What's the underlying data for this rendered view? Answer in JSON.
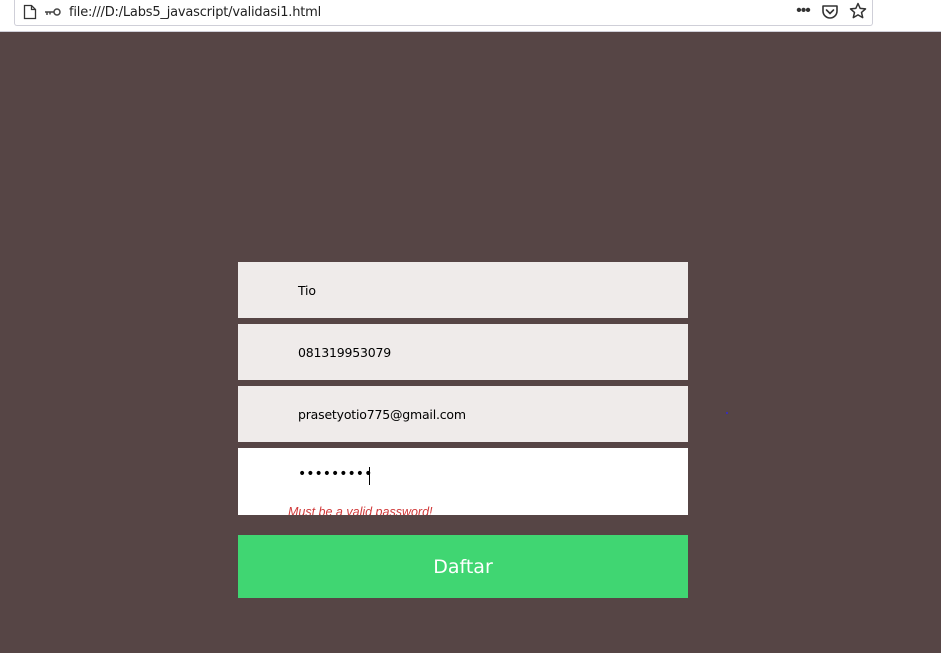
{
  "browser": {
    "url": "file:///D:/Labs5_javascript/validasi1.html",
    "icons": [
      "page-icon",
      "key-icon",
      "more-icon",
      "pocket-icon",
      "star-icon"
    ]
  },
  "form": {
    "name_value": "Tio",
    "phone_value": "081319953079",
    "email_value": "prasetyotio775@gmail.com",
    "password_masked": "•••••••••",
    "password_error": "Must be a valid password!",
    "submit_label": "Daftar"
  },
  "colors": {
    "background": "#564545",
    "field_bg": "#efebea",
    "active_field_bg": "#ffffff",
    "submit_bg": "#40d672",
    "error_text": "#d03a3a"
  }
}
